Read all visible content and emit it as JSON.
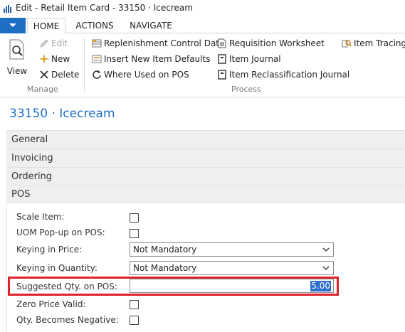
{
  "window": {
    "title": "Edit - Retail Item Card - 33150 · Icecream"
  },
  "tabs": [
    {
      "label": "HOME",
      "active": true
    },
    {
      "label": "ACTIONS",
      "active": false
    },
    {
      "label": "NAVIGATE",
      "active": false
    }
  ],
  "ribbon": {
    "manage": {
      "group_label": "Manage",
      "view": "View",
      "edit": "Edit",
      "new": "New",
      "delete": "Delete"
    },
    "process": {
      "group_label": "Process",
      "replenishment": "Replenishment Control Data",
      "insert_defaults": "Insert New Item Defaults",
      "where_used": "Where Used on POS",
      "requisition": "Requisition Worksheet",
      "item_journal": "Item Journal",
      "reclass_journal": "Item Reclassification Journal",
      "item_tracing": "Item Tracing"
    }
  },
  "page": {
    "title": "33150 · Icecream"
  },
  "fasttabs": [
    "General",
    "Invoicing",
    "Ordering",
    "POS"
  ],
  "pos": {
    "scale_item": {
      "label": "Scale Item:",
      "checked": false
    },
    "uom_popup": {
      "label": "UOM Pop-up on POS:",
      "checked": false
    },
    "keying_price": {
      "label": "Keying in Price:",
      "value": "Not Mandatory"
    },
    "keying_qty": {
      "label": "Keying in Quantity:",
      "value": "Not Mandatory"
    },
    "suggested_qty": {
      "label": "Suggested Qty. on POS:",
      "value": "5.00"
    },
    "zero_price": {
      "label": "Zero Price Valid:",
      "checked": false
    },
    "qty_negative": {
      "label": "Qty. Becomes Negative:",
      "checked": false
    }
  },
  "colors": {
    "accent": "#1e6fc4",
    "highlight": "#e0202a",
    "selection": "#2f6fd0"
  }
}
